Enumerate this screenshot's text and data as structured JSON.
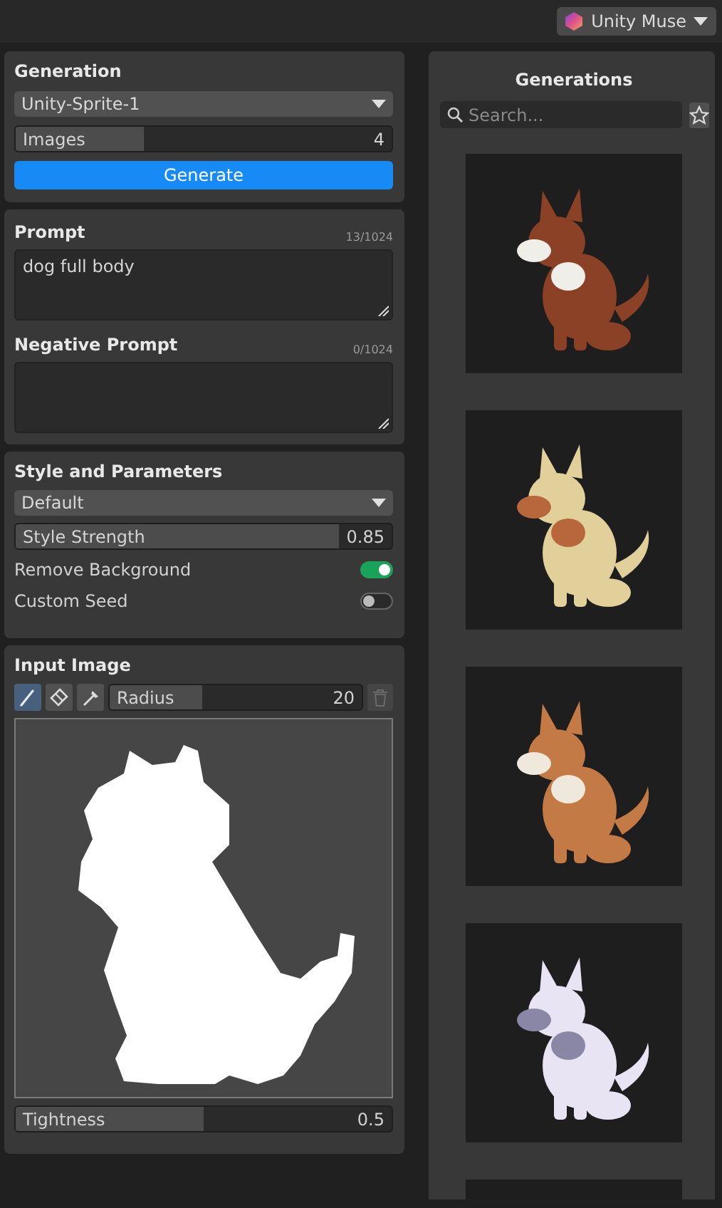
{
  "toolbar": {
    "account": "Unity Muse"
  },
  "generation": {
    "title": "Generation",
    "model": "Unity-Sprite-1",
    "images": {
      "label": "Images",
      "value": "4",
      "level": 0.34
    },
    "button": "Generate"
  },
  "prompt": {
    "title": "Prompt",
    "counter": "13/1024",
    "value": "dog full body"
  },
  "negative_prompt": {
    "title": "Negative Prompt",
    "counter": "0/1024"
  },
  "style": {
    "title": "Style and Parameters",
    "preset": "Default",
    "strength": {
      "label": "Style Strength",
      "value": "0.85",
      "level": 0.86
    },
    "toggles": [
      {
        "label": "Remove Background",
        "on": true
      },
      {
        "label": "Custom Seed",
        "on": false
      }
    ]
  },
  "input_image": {
    "title": "Input Image",
    "tools": [
      {
        "kind": "brush",
        "selected": true
      },
      {
        "kind": "eraser",
        "selected": false
      },
      {
        "kind": "eyedropper",
        "selected": false
      }
    ],
    "radius": {
      "label": "Radius",
      "value": "20",
      "level": 0.37
    },
    "tightness": {
      "label": "Tightness",
      "value": "0.5",
      "level": 0.5
    }
  },
  "generations": {
    "title": "Generations",
    "search_placeholder": "Search..."
  }
}
